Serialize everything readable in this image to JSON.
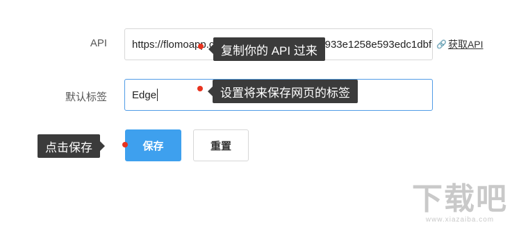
{
  "form": {
    "api_label": "API",
    "api_value": "https://flomoapp.com/iwh/Njg5Mw/56cf9fe933e1258e593edc1dbf",
    "api_link": "获取API",
    "tag_label": "默认标签",
    "tag_value": "Edge",
    "save_button": "保存",
    "reset_button": "重置"
  },
  "tooltips": {
    "copy_api": "复制你的 API 过来",
    "set_tag": "设置将来保存网页的标签",
    "click_save": "点击保存"
  },
  "watermark": {
    "title": "下载吧",
    "url": "www.xiazaiba.com"
  },
  "icons": [
    "link-icon"
  ],
  "colors": {
    "primary": "#3ea0ee",
    "tooltip_bg": "#3b3b3b",
    "marker": "#e8331f",
    "focus_border": "#4f9be6"
  }
}
